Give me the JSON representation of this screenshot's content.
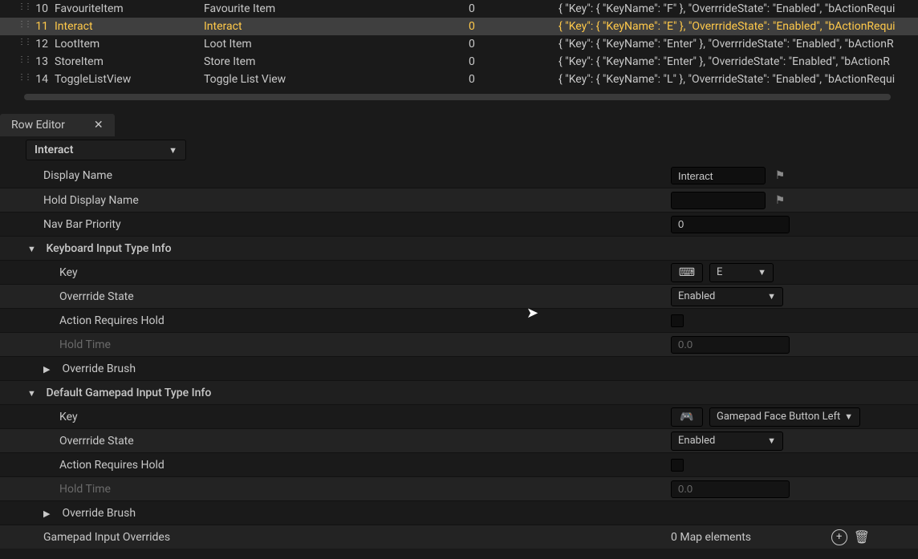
{
  "table": {
    "rows": [
      {
        "idx": "10",
        "name": "FavouriteItem",
        "disp": "Favourite Item",
        "num": "0",
        "json": "{ \"Key\": { \"KeyName\": \"F\" }, \"OverrrideState\": \"Enabled\", \"bActionRequi"
      },
      {
        "idx": "11",
        "name": "Interact",
        "disp": "Interact",
        "num": "0",
        "json": "{ \"Key\": { \"KeyName\": \"E\" }, \"OverrrideState\": \"Enabled\", \"bActionRequi",
        "selected": true
      },
      {
        "idx": "12",
        "name": "LootItem",
        "disp": "Loot Item",
        "num": "0",
        "json": "{ \"Key\": { \"KeyName\": \"Enter\" }, \"OverrrideState\": \"Enabled\", \"bActionR"
      },
      {
        "idx": "13",
        "name": "StoreItem",
        "disp": "Store Item",
        "num": "0",
        "json": "{ \"Key\": { \"KeyName\": \"Enter\" }, \"OverrideState\": \"Enabled\", \"bActionR"
      },
      {
        "idx": "14",
        "name": "ToggleListView",
        "disp": "Toggle List View",
        "num": "0",
        "json": "{ \"Key\": { \"KeyName\": \"L\" }, \"OverrrideState\": \"Enabled\", \"bActionRequi"
      }
    ]
  },
  "tab": {
    "title": "Row Editor"
  },
  "rowSelect": "Interact",
  "props": {
    "displayName": {
      "label": "Display Name",
      "value": "Interact"
    },
    "holdDisplay": {
      "label": "Hold Display Name",
      "value": ""
    },
    "navPriority": {
      "label": "Nav Bar Priority",
      "value": "0"
    },
    "kbSection": {
      "label": "Keyboard Input Type Info"
    },
    "kbKey": {
      "label": "Key",
      "value": "E"
    },
    "kbOverride": {
      "label": "Overrride State",
      "value": "Enabled"
    },
    "kbHold": {
      "label": "Action Requires Hold"
    },
    "kbHoldTime": {
      "label": "Hold Time",
      "value": "0.0"
    },
    "kbBrush": {
      "label": "Override Brush"
    },
    "gpSection": {
      "label": "Default Gamepad Input Type Info"
    },
    "gpKey": {
      "label": "Key",
      "value": "Gamepad Face Button Left"
    },
    "gpOverride": {
      "label": "Overrride State",
      "value": "Enabled"
    },
    "gpHold": {
      "label": "Action Requires Hold"
    },
    "gpHoldTime": {
      "label": "Hold Time",
      "value": "0.0"
    },
    "gpBrush": {
      "label": "Override Brush"
    },
    "gpOverrides": {
      "label": "Gamepad Input Overrides",
      "value": "0 Map elements"
    }
  }
}
